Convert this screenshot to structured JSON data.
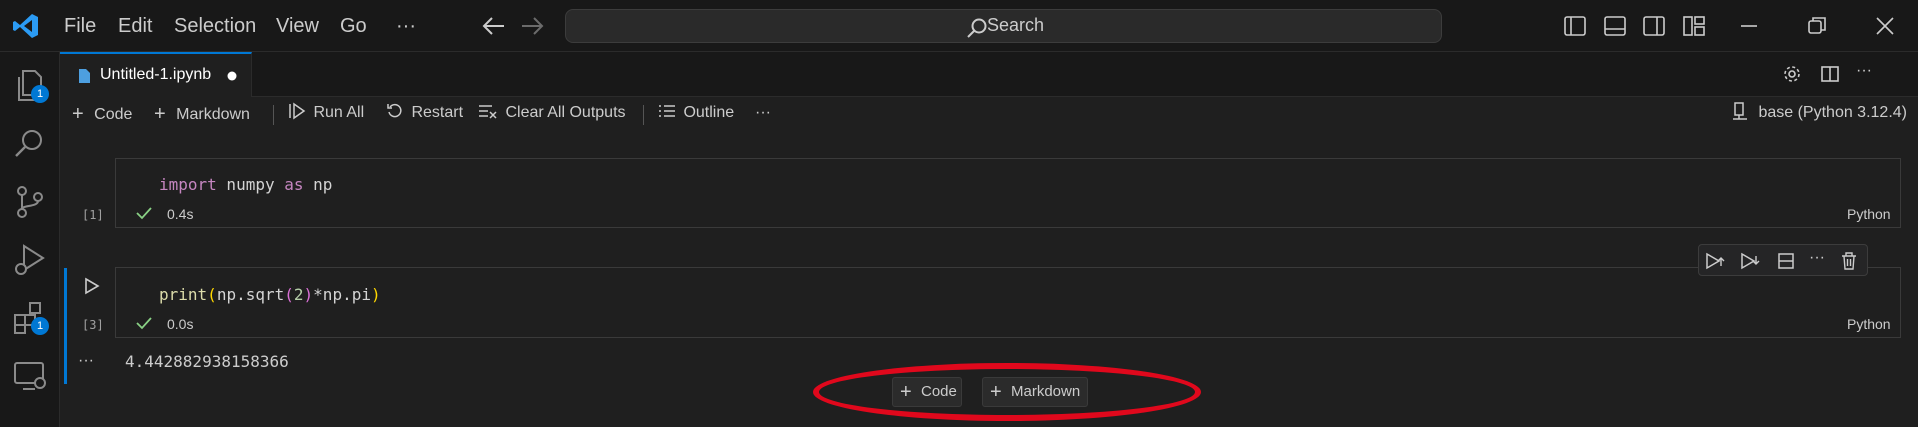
{
  "titlebar": {
    "menu": [
      "File",
      "Edit",
      "Selection",
      "View",
      "Go",
      "···"
    ],
    "search_placeholder": "Search"
  },
  "activity": {
    "explorer_badge": "1",
    "extensions_badge": "1"
  },
  "tab": {
    "name": "Untitled-1.ipynb"
  },
  "toolbar": {
    "add_code": "Code",
    "add_markdown": "Markdown",
    "run_all": "Run All",
    "restart": "Restart",
    "clear_outputs": "Clear All Outputs",
    "outline": "Outline",
    "more": "···",
    "kernel": "base (Python 3.12.4)"
  },
  "cells": [
    {
      "exec_count": "[1]",
      "code_tokens": [
        "import",
        " numpy ",
        "as",
        " np"
      ],
      "time": "0.4s",
      "language": "Python"
    },
    {
      "exec_count": "[3]",
      "code_tokens": [
        "print",
        "(",
        "np.sqrt",
        "(",
        "2",
        ")",
        "*np.pi",
        ")"
      ],
      "time": "0.0s",
      "language": "Python",
      "output": "4.442882938158366",
      "output_more": "···"
    }
  ],
  "insert_buttons": {
    "code": "Code",
    "markdown": "Markdown"
  },
  "colors": {
    "accent": "#0078d4",
    "success": "#89d185",
    "highlight": "#e0081c"
  }
}
